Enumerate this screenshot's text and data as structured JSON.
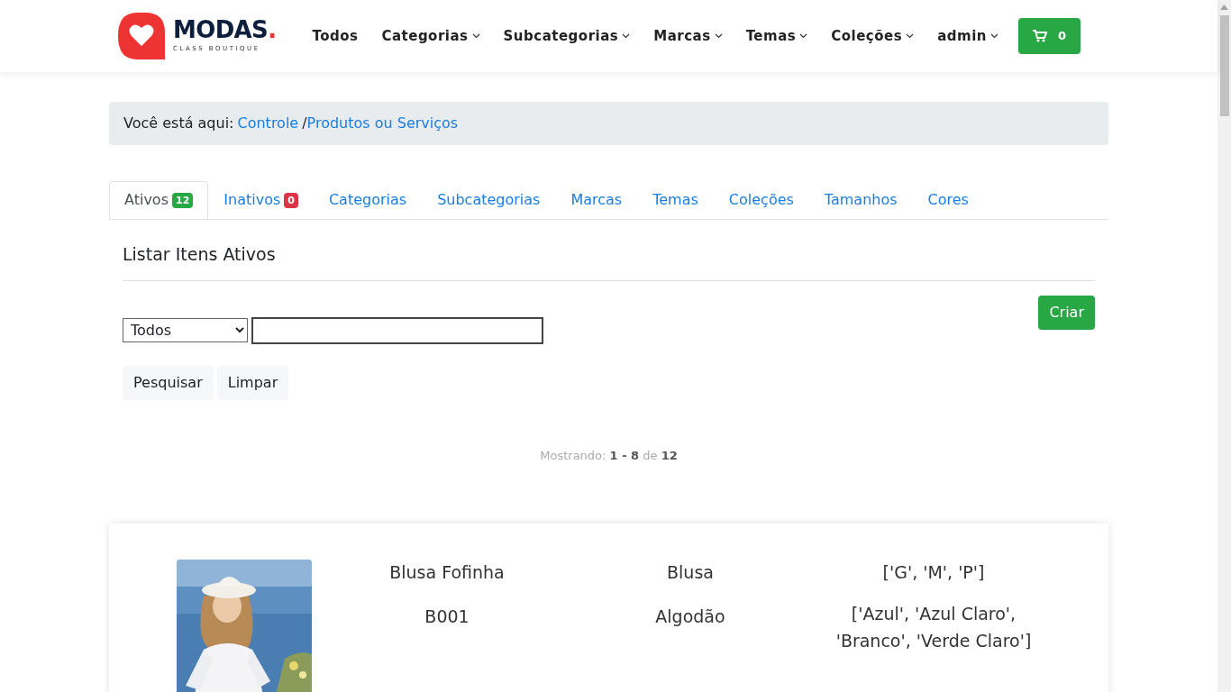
{
  "brand": {
    "name": "MODAS",
    "dot": ".",
    "tagline": "CLASS BOUTIQUE"
  },
  "nav": [
    {
      "label": "Todos",
      "dropdown": false
    },
    {
      "label": "Categorias",
      "dropdown": true
    },
    {
      "label": "Subcategorias",
      "dropdown": true
    },
    {
      "label": "Marcas",
      "dropdown": true
    },
    {
      "label": "Temas",
      "dropdown": true
    },
    {
      "label": "Coleções",
      "dropdown": true
    },
    {
      "label": "admin",
      "dropdown": true
    }
  ],
  "cart": {
    "count": "0"
  },
  "breadcrumb": {
    "prefix": "Você está aqui:",
    "links": [
      "Controle",
      "Produtos ou Serviços"
    ],
    "separator": "/"
  },
  "tabs": [
    {
      "label": "Ativos",
      "badge": "12",
      "color": "#28a745",
      "selected": true
    },
    {
      "label": "Inativos",
      "badge": "0",
      "color": "#dc3545",
      "selected": false
    },
    {
      "label": "Categorias",
      "selected": false
    },
    {
      "label": "Subcategorias",
      "selected": false
    },
    {
      "label": "Marcas",
      "selected": false
    },
    {
      "label": "Temas",
      "selected": false
    },
    {
      "label": "Coleções",
      "selected": false
    },
    {
      "label": "Tamanhos",
      "selected": false
    },
    {
      "label": "Cores",
      "selected": false
    }
  ],
  "section_title": "Listar Itens Ativos",
  "create_button": "Criar",
  "filter": {
    "select_value": "Todos"
  },
  "buttons": [
    "Pesquisar",
    "Limpar"
  ],
  "pagination": "Mostrando: **1 - 8** de **12**",
  "products": [
    {
      "name": "Blusa Fofinha",
      "code": "B001",
      "category": "Blusa",
      "material": "Algodão",
      "sizes": "['G', 'M', 'P']",
      "colors": "['Azul', 'Azul Claro', 'Branco', 'Verde Claro']"
    }
  ]
}
